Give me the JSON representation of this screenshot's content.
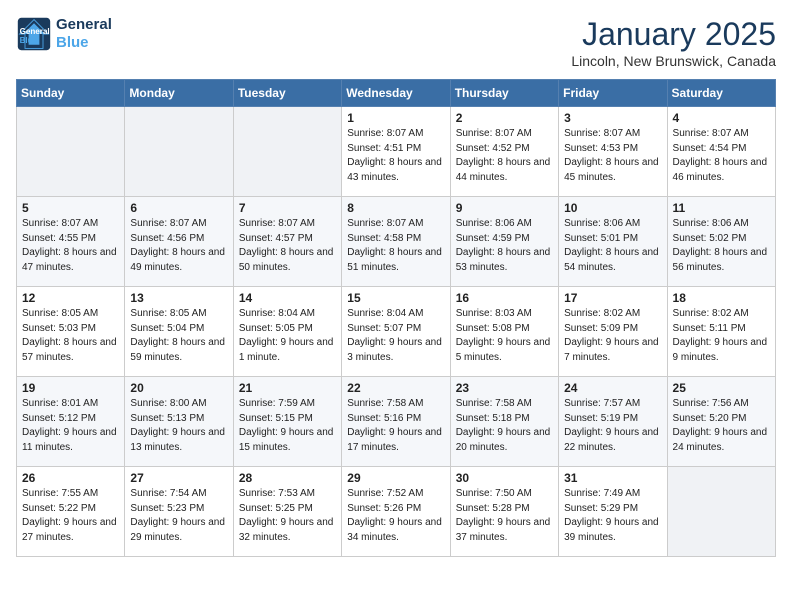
{
  "header": {
    "logo_line1": "General",
    "logo_line2": "Blue",
    "month": "January 2025",
    "location": "Lincoln, New Brunswick, Canada"
  },
  "weekdays": [
    "Sunday",
    "Monday",
    "Tuesday",
    "Wednesday",
    "Thursday",
    "Friday",
    "Saturday"
  ],
  "weeks": [
    [
      {
        "day": "",
        "info": ""
      },
      {
        "day": "",
        "info": ""
      },
      {
        "day": "",
        "info": ""
      },
      {
        "day": "1",
        "info": "Sunrise: 8:07 AM\nSunset: 4:51 PM\nDaylight: 8 hours and 43 minutes."
      },
      {
        "day": "2",
        "info": "Sunrise: 8:07 AM\nSunset: 4:52 PM\nDaylight: 8 hours and 44 minutes."
      },
      {
        "day": "3",
        "info": "Sunrise: 8:07 AM\nSunset: 4:53 PM\nDaylight: 8 hours and 45 minutes."
      },
      {
        "day": "4",
        "info": "Sunrise: 8:07 AM\nSunset: 4:54 PM\nDaylight: 8 hours and 46 minutes."
      }
    ],
    [
      {
        "day": "5",
        "info": "Sunrise: 8:07 AM\nSunset: 4:55 PM\nDaylight: 8 hours and 47 minutes."
      },
      {
        "day": "6",
        "info": "Sunrise: 8:07 AM\nSunset: 4:56 PM\nDaylight: 8 hours and 49 minutes."
      },
      {
        "day": "7",
        "info": "Sunrise: 8:07 AM\nSunset: 4:57 PM\nDaylight: 8 hours and 50 minutes."
      },
      {
        "day": "8",
        "info": "Sunrise: 8:07 AM\nSunset: 4:58 PM\nDaylight: 8 hours and 51 minutes."
      },
      {
        "day": "9",
        "info": "Sunrise: 8:06 AM\nSunset: 4:59 PM\nDaylight: 8 hours and 53 minutes."
      },
      {
        "day": "10",
        "info": "Sunrise: 8:06 AM\nSunset: 5:01 PM\nDaylight: 8 hours and 54 minutes."
      },
      {
        "day": "11",
        "info": "Sunrise: 8:06 AM\nSunset: 5:02 PM\nDaylight: 8 hours and 56 minutes."
      }
    ],
    [
      {
        "day": "12",
        "info": "Sunrise: 8:05 AM\nSunset: 5:03 PM\nDaylight: 8 hours and 57 minutes."
      },
      {
        "day": "13",
        "info": "Sunrise: 8:05 AM\nSunset: 5:04 PM\nDaylight: 8 hours and 59 minutes."
      },
      {
        "day": "14",
        "info": "Sunrise: 8:04 AM\nSunset: 5:05 PM\nDaylight: 9 hours and 1 minute."
      },
      {
        "day": "15",
        "info": "Sunrise: 8:04 AM\nSunset: 5:07 PM\nDaylight: 9 hours and 3 minutes."
      },
      {
        "day": "16",
        "info": "Sunrise: 8:03 AM\nSunset: 5:08 PM\nDaylight: 9 hours and 5 minutes."
      },
      {
        "day": "17",
        "info": "Sunrise: 8:02 AM\nSunset: 5:09 PM\nDaylight: 9 hours and 7 minutes."
      },
      {
        "day": "18",
        "info": "Sunrise: 8:02 AM\nSunset: 5:11 PM\nDaylight: 9 hours and 9 minutes."
      }
    ],
    [
      {
        "day": "19",
        "info": "Sunrise: 8:01 AM\nSunset: 5:12 PM\nDaylight: 9 hours and 11 minutes."
      },
      {
        "day": "20",
        "info": "Sunrise: 8:00 AM\nSunset: 5:13 PM\nDaylight: 9 hours and 13 minutes."
      },
      {
        "day": "21",
        "info": "Sunrise: 7:59 AM\nSunset: 5:15 PM\nDaylight: 9 hours and 15 minutes."
      },
      {
        "day": "22",
        "info": "Sunrise: 7:58 AM\nSunset: 5:16 PM\nDaylight: 9 hours and 17 minutes."
      },
      {
        "day": "23",
        "info": "Sunrise: 7:58 AM\nSunset: 5:18 PM\nDaylight: 9 hours and 20 minutes."
      },
      {
        "day": "24",
        "info": "Sunrise: 7:57 AM\nSunset: 5:19 PM\nDaylight: 9 hours and 22 minutes."
      },
      {
        "day": "25",
        "info": "Sunrise: 7:56 AM\nSunset: 5:20 PM\nDaylight: 9 hours and 24 minutes."
      }
    ],
    [
      {
        "day": "26",
        "info": "Sunrise: 7:55 AM\nSunset: 5:22 PM\nDaylight: 9 hours and 27 minutes."
      },
      {
        "day": "27",
        "info": "Sunrise: 7:54 AM\nSunset: 5:23 PM\nDaylight: 9 hours and 29 minutes."
      },
      {
        "day": "28",
        "info": "Sunrise: 7:53 AM\nSunset: 5:25 PM\nDaylight: 9 hours and 32 minutes."
      },
      {
        "day": "29",
        "info": "Sunrise: 7:52 AM\nSunset: 5:26 PM\nDaylight: 9 hours and 34 minutes."
      },
      {
        "day": "30",
        "info": "Sunrise: 7:50 AM\nSunset: 5:28 PM\nDaylight: 9 hours and 37 minutes."
      },
      {
        "day": "31",
        "info": "Sunrise: 7:49 AM\nSunset: 5:29 PM\nDaylight: 9 hours and 39 minutes."
      },
      {
        "day": "",
        "info": ""
      }
    ]
  ]
}
